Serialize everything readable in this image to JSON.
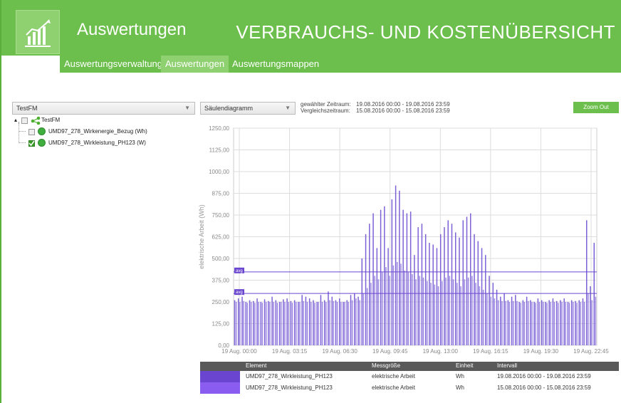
{
  "header": {
    "app_title": "Auswertungen",
    "page_heading": "VERBRAUCHS- UND KOSTENÜBERSICHT"
  },
  "subnav": {
    "tabs": [
      {
        "label": "Auswertungsverwaltung"
      },
      {
        "label": "Auswertungen"
      },
      {
        "label": "Auswertungsmappen"
      }
    ]
  },
  "toolbar": {
    "site_select": "TestFM",
    "chart_type_select": "Säulendiagramm",
    "period_label": "gewählter Zeitraum:",
    "period_value": "19.08.2016 00:00 - 19.08.2016 23:59",
    "compare_label": "Vergleichszeitraum:",
    "compare_value": "15.08.2016 00:00 - 15.08.2016 23:59",
    "zoom_out": "Zoom Out"
  },
  "tree": {
    "root": "TestFM",
    "items": [
      {
        "label": "UMD97_278_Wirkenergie_Bezug (Wh)",
        "checked": false
      },
      {
        "label": "UMD97_278_Wirkleistung_PH123 (W)",
        "checked": true
      }
    ]
  },
  "chart_data": {
    "type": "bar",
    "ylabel": "elektrische Arbeit (Wh)",
    "ylim": [
      0,
      1250
    ],
    "y_ticks": [
      "1250,00",
      "1125,00",
      "1000,00",
      "875,00",
      "750,00",
      "625,00",
      "500,00",
      "375,00",
      "250,00",
      "125,00",
      "0,00"
    ],
    "x_ticks": [
      "19 Aug. 00:00",
      "19 Aug. 03:15",
      "19 Aug. 06:30",
      "19 Aug. 09:45",
      "19 Aug. 13:00",
      "19 Aug. 16:15",
      "19 Aug. 19:30",
      "19 Aug. 22:45"
    ],
    "avg_labels": [
      "avg",
      "avg"
    ],
    "series": [
      {
        "name": "19.08.2016",
        "color": "#7b5fd6",
        "values": [
          260,
          270,
          280,
          250,
          260,
          255,
          270,
          250,
          265,
          255,
          280,
          260,
          250,
          265,
          270,
          255,
          260,
          250,
          290,
          280,
          270,
          260,
          250,
          290,
          260,
          310,
          280,
          260,
          270,
          250,
          260,
          290,
          300,
          280,
          500,
          640,
          700,
          760,
          560,
          780,
          800,
          560,
          840,
          920,
          890,
          780,
          760,
          770,
          520,
          680,
          700,
          640,
          590,
          580,
          560,
          640,
          680,
          720,
          700,
          650,
          620,
          720,
          740,
          760,
          640,
          600,
          560,
          520,
          400,
          360,
          320,
          280,
          300,
          260,
          280,
          290,
          250,
          260,
          280,
          260,
          250,
          270,
          260,
          250,
          260,
          270,
          255,
          260,
          270,
          250,
          260,
          255,
          260,
          270,
          720,
          340,
          590
        ]
      },
      {
        "name": "15.08.2016",
        "color": "#9a86e0",
        "values": [
          250,
          250,
          255,
          245,
          250,
          245,
          250,
          245,
          250,
          250,
          250,
          245,
          250,
          250,
          250,
          245,
          250,
          250,
          255,
          250,
          250,
          245,
          250,
          250,
          250,
          260,
          255,
          250,
          250,
          250,
          250,
          260,
          270,
          260,
          300,
          330,
          360,
          400,
          380,
          420,
          450,
          400,
          460,
          480,
          470,
          430,
          420,
          410,
          380,
          400,
          390,
          370,
          360,
          350,
          340,
          370,
          390,
          400,
          380,
          360,
          340,
          380,
          390,
          400,
          360,
          340,
          320,
          300,
          280,
          270,
          260,
          255,
          255,
          250,
          255,
          255,
          245,
          250,
          255,
          250,
          245,
          250,
          250,
          245,
          250,
          250,
          245,
          250,
          250,
          245,
          250,
          245,
          250,
          250,
          300,
          260,
          280
        ]
      }
    ]
  },
  "legend": {
    "headers": [
      "Element",
      "Messgröße",
      "Einheit",
      "Intervall"
    ],
    "rows": [
      {
        "element": "UMD97_278_Wirkleistung_PH123",
        "measure": "elektrische Arbeit",
        "unit": "Wh",
        "interval": "19.08.2016 00:00 - 19.08.2016 23:59",
        "color": "#6a46d0"
      },
      {
        "element": "UMD97_278_Wirkleistung_PH123",
        "measure": "elektrische Arbeit",
        "unit": "Wh",
        "interval": "15.08.2016 00:00 - 15.08.2016 23:59",
        "color": "#8a5cf0"
      }
    ]
  }
}
